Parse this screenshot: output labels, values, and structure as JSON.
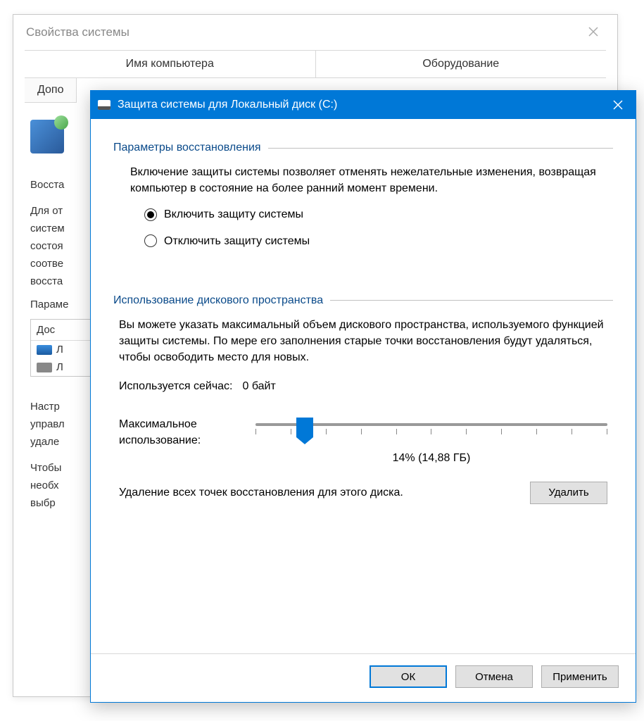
{
  "bg": {
    "title": "Свойства системы",
    "tabs": {
      "computer_name": "Имя компьютера",
      "hardware": "Оборудование"
    },
    "tab2": "Допо",
    "section_label": "Восста",
    "desc_lines": [
      "Для от",
      "систем",
      "состоя",
      "соотве",
      "восста"
    ],
    "params_label": "Параме",
    "list_header": "Дос",
    "list_item_l": "Л",
    "bottom_lines": [
      "Настр",
      "управл",
      "удале",
      "Чтобы",
      "необх",
      "выбр"
    ]
  },
  "dialog": {
    "title": "Защита системы для Локальный диск (C:)",
    "recovery": {
      "header": "Параметры восстановления",
      "desc": "Включение защиты системы позволяет отменять нежелательные изменения, возвращая компьютер в состояние на более ранний момент времени.",
      "enable": "Включить защиту системы",
      "disable": "Отключить защиту системы"
    },
    "disk": {
      "header": "Использование дискового пространства",
      "desc": "Вы можете указать максимальный объем дискового пространства, используемого функцией защиты системы. По мере его заполнения старые точки восстановления будут удаляться, чтобы освободить место для новых.",
      "current_label": "Используется сейчас:",
      "current_value": "0 байт",
      "max_label": "Максимальное использование:",
      "slider_value": "14% (14,88 ГБ)",
      "delete_text": "Удаление всех точек восстановления для этого диска.",
      "delete_btn": "Удалить"
    },
    "buttons": {
      "ok": "ОК",
      "cancel": "Отмена",
      "apply": "Применить"
    }
  }
}
